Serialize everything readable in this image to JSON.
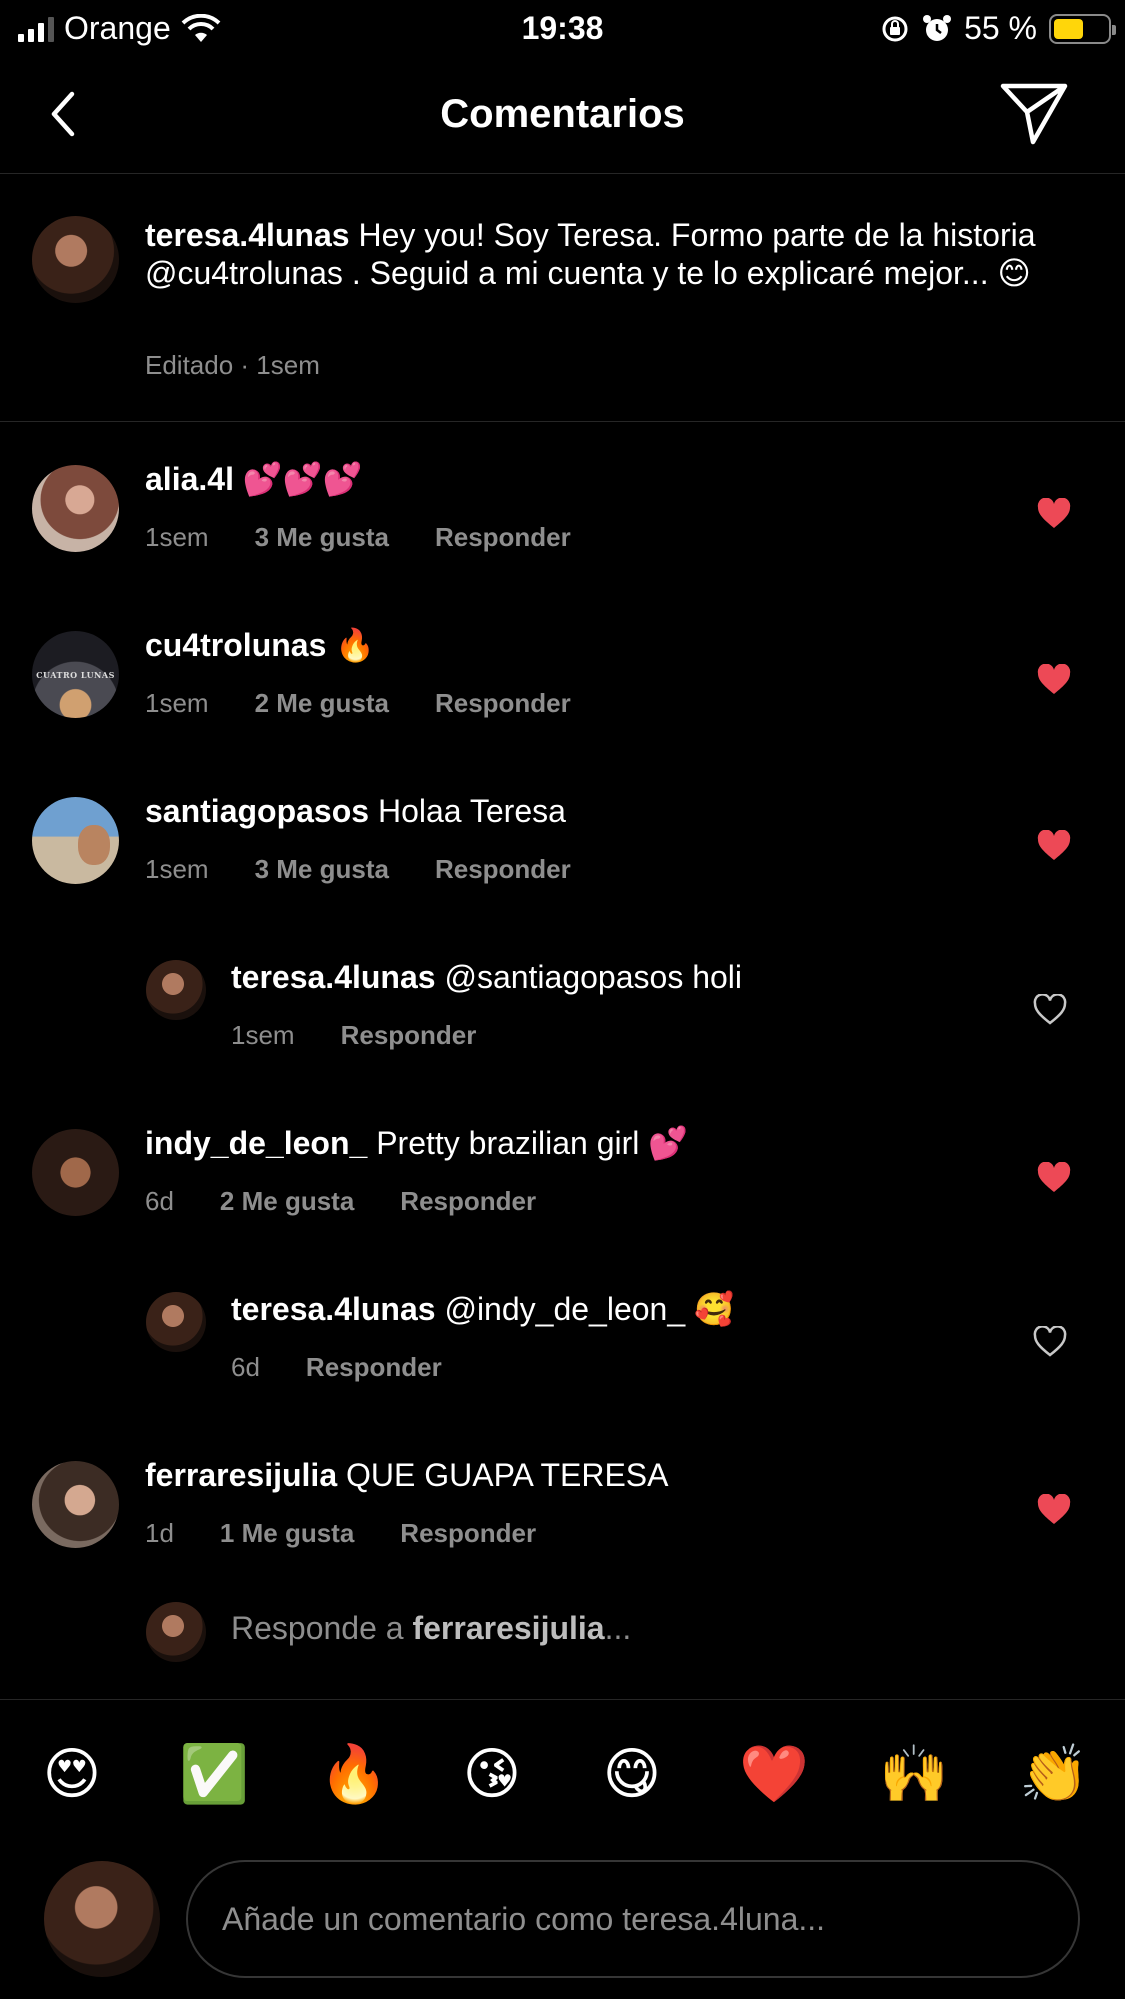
{
  "status_bar": {
    "carrier": "Orange",
    "time": "19:38",
    "battery_percent": "55 %",
    "battery_level": 0.55
  },
  "header": {
    "title": "Comentarios"
  },
  "caption": {
    "username": "teresa.4lunas",
    "text": "Hey you! Soy Teresa. Formo parte de la historia @cu4trolunas . Seguid a mi cuenta y te lo explicaré mejor... 😊",
    "meta": "Editado · 1sem"
  },
  "comments": [
    {
      "username": "alia.4l",
      "text": "💕💕💕",
      "time": "1sem",
      "likes": "3 Me gusta",
      "reply": "Responder",
      "liked": true
    },
    {
      "username": "cu4trolunas",
      "text": "🔥",
      "time": "1sem",
      "likes": "2 Me gusta",
      "reply": "Responder",
      "liked": true,
      "avatar_text": "CUATRO LUNAS"
    },
    {
      "username": "santiagopasos",
      "text": "Holaa Teresa",
      "time": "1sem",
      "likes": "3 Me gusta",
      "reply": "Responder",
      "liked": true
    },
    {
      "username": "teresa.4lunas",
      "text": "@santiagopasos holi",
      "time": "1sem",
      "likes": "",
      "reply": "Responder",
      "liked": false,
      "is_reply": true
    },
    {
      "username": "indy_de_leon_",
      "text": "Pretty brazilian girl 💕",
      "time": "6d",
      "likes": "2 Me gusta",
      "reply": "Responder",
      "liked": true
    },
    {
      "username": "teresa.4lunas",
      "text": "@indy_de_leon_ 🥰",
      "time": "6d",
      "likes": "",
      "reply": "Responder",
      "liked": false,
      "is_reply": true
    },
    {
      "username": "ferraresijulia",
      "text": "QUE GUAPA TERESA",
      "time": "1d",
      "likes": "1 Me gusta",
      "reply": "Responder",
      "liked": true
    }
  ],
  "reply_bar": {
    "prefix": "Responde a ",
    "username": "ferraresijulia",
    "suffix": "..."
  },
  "emoji_bar": [
    "😍",
    "✅",
    "🔥",
    "😘",
    "😋",
    "❤️",
    "🙌",
    "👏"
  ],
  "composer": {
    "placeholder": "Añade un comentario como teresa.4luna..."
  },
  "colors": {
    "background": "#000000",
    "heart_liked": "#ed4956",
    "secondary_text": "#8e8e8e",
    "battery": "#ffd60a"
  }
}
